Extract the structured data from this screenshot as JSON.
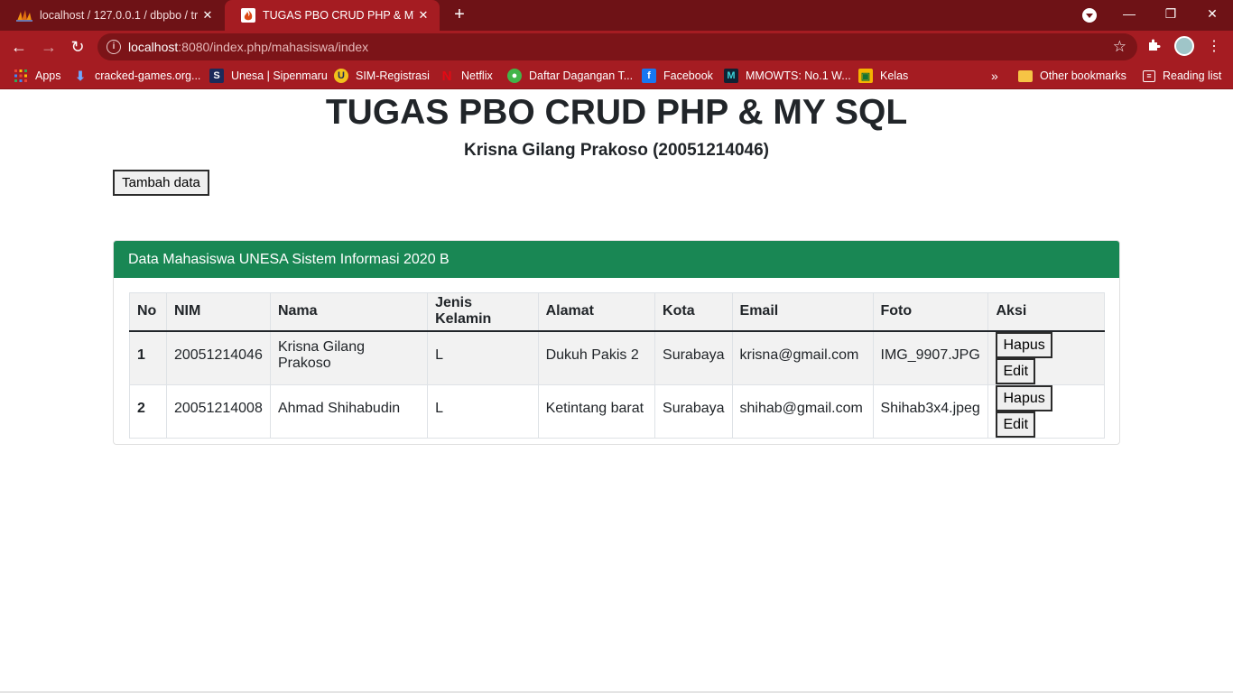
{
  "browser": {
    "tabs": [
      {
        "title": "localhost / 127.0.0.1 / dbpbo / tr",
        "icon": "phpmyadmin-icon"
      },
      {
        "title": "TUGAS PBO CRUD PHP & MY SQL",
        "icon": "codeigniter-icon"
      }
    ],
    "url_host": "localhost",
    "url_rest": ":8080/index.php/mahasiswa/index",
    "bookmarks": [
      {
        "label": "Apps",
        "icon": "apps-grid-icon"
      },
      {
        "label": "cracked-games.org...",
        "icon": "download-arrow-icon"
      },
      {
        "label": "Unesa | Sipenmaru",
        "icon": "sipenmaru-icon"
      },
      {
        "label": "SIM-Registrasi",
        "icon": "unesa-logo-icon"
      },
      {
        "label": "Netflix",
        "icon": "netflix-icon"
      },
      {
        "label": "Daftar Dagangan T...",
        "icon": "tokopedia-icon"
      },
      {
        "label": "Facebook",
        "icon": "facebook-icon"
      },
      {
        "label": "MMOWTS: No.1 W...",
        "icon": "mmowts-icon"
      },
      {
        "label": "Kelas",
        "icon": "classroom-icon"
      }
    ],
    "overflow": "»",
    "other_bookmarks": "Other bookmarks",
    "reading_list": "Reading list"
  },
  "page": {
    "title": "TUGAS PBO CRUD PHP & MY SQL",
    "subtitle": "Krisna Gilang Prakoso (20051214046)",
    "add_button": "Tambah data",
    "card_title": "Data Mahasiswa UNESA Sistem Informasi 2020 B",
    "columns": [
      "No",
      "NIM",
      "Nama",
      "Jenis Kelamin",
      "Alamat",
      "Kota",
      "Email",
      "Foto",
      "Aksi"
    ],
    "rows": [
      {
        "no": "1",
        "nim": "20051214046",
        "nama": "Krisna Gilang Prakoso",
        "jk": "L",
        "alamat": "Dukuh Pakis 2",
        "kota": "Surabaya",
        "email": "krisna@gmail.com",
        "foto": "IMG_9907.JPG",
        "hapus": "Hapus",
        "edit": "Edit"
      },
      {
        "no": "2",
        "nim": "20051214008",
        "nama": "Ahmad Shihabudin",
        "jk": "L",
        "alamat": "Ketintang barat",
        "kota": "Surabaya",
        "email": "shihab@gmail.com",
        "foto": "Shihab3x4.jpeg",
        "hapus": "Hapus",
        "edit": "Edit"
      }
    ]
  },
  "colors": {
    "tabbar": "#6e1216",
    "toolbar": "#a51c22",
    "card_header": "#198754"
  }
}
